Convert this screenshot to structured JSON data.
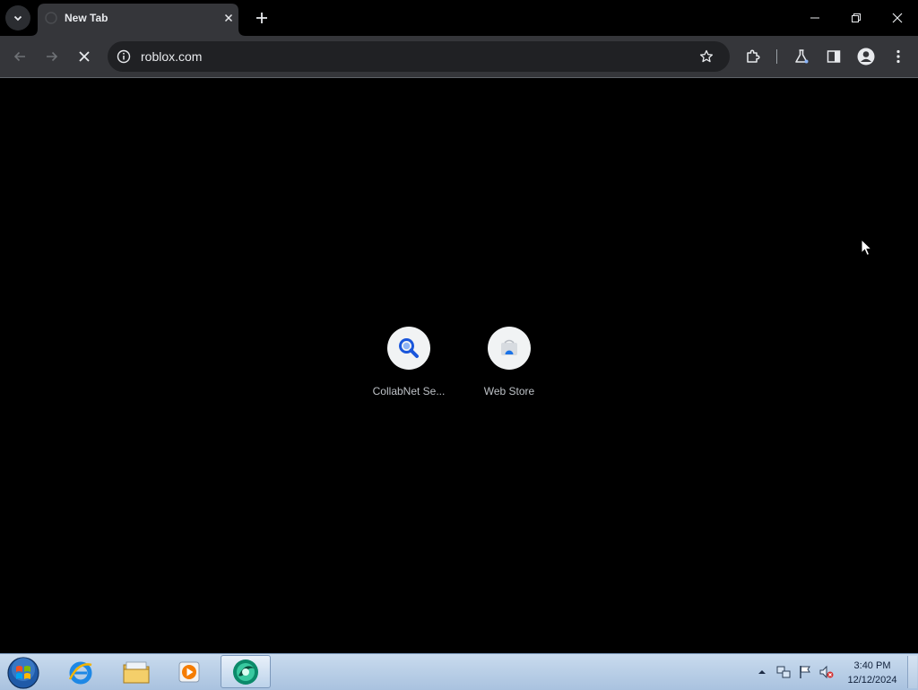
{
  "browser": {
    "tab": {
      "title": "New Tab",
      "favicon": "new-tab-icon"
    },
    "address_bar": {
      "url": "roblox.com",
      "loading": true
    },
    "toolbar_icons": [
      "back-arrow-icon",
      "forward-arrow-icon",
      "stop-loading-icon",
      "site-info-icon",
      "bookmark-star-icon",
      "extensions-puzzle-icon",
      "labs-flask-icon",
      "side-panel-icon",
      "profile-avatar-icon",
      "more-menu-icon"
    ],
    "window_controls": [
      "minimize-icon",
      "restore-icon",
      "close-icon"
    ]
  },
  "shortcuts": [
    {
      "label": "CollabNet Se...",
      "icon": "magnifier-icon"
    },
    {
      "label": "Web Store",
      "icon": "web-store-icon"
    }
  ],
  "taskbar": {
    "pinned": [
      "start-orb",
      "internet-explorer-icon",
      "file-explorer-icon",
      "media-player-icon",
      "chrome-browser-icon"
    ],
    "tray": [
      "show-hidden-icons-arrow",
      "network-icon",
      "action-center-flag-icon",
      "volume-muted-icon"
    ],
    "clock": {
      "time": "3:40 PM",
      "date": "12/12/2024"
    }
  },
  "colors": {
    "accent_blue": "#1a73e8",
    "toolbar": "#35363a",
    "omnibox": "#202124",
    "taskbar": "#b9cfe8"
  }
}
